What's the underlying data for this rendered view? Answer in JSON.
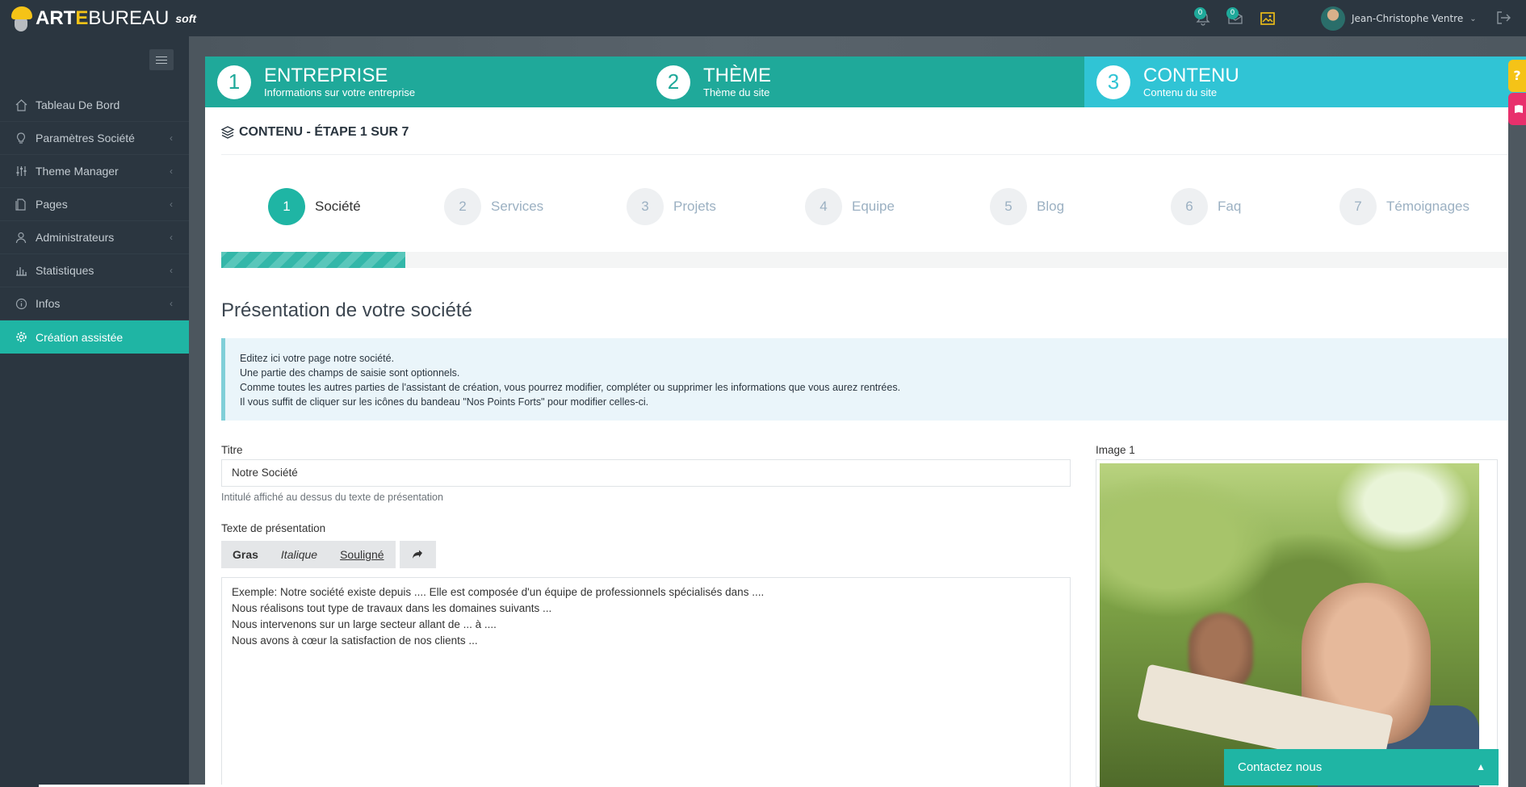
{
  "brand": {
    "logo_part1": "ART",
    "logo_e": "E",
    "logo_part2": "BUREAU",
    "logo_suffix": "soft"
  },
  "topbar": {
    "notifications_count": "0",
    "messages_count": "0",
    "user_name": "Jean-Christophe Ventre"
  },
  "sidebar": {
    "items": [
      {
        "label": "Tableau De Bord",
        "icon": "home-icon"
      },
      {
        "label": "Paramètres Société",
        "icon": "lightbulb-icon"
      },
      {
        "label": "Theme Manager",
        "icon": "sliders-icon"
      },
      {
        "label": "Pages",
        "icon": "pages-icon"
      },
      {
        "label": "Administrateurs",
        "icon": "user-icon"
      },
      {
        "label": "Statistiques",
        "icon": "bar-chart-icon"
      },
      {
        "label": "Infos",
        "icon": "info-icon"
      },
      {
        "label": "Création assistée",
        "icon": "gear-icon"
      }
    ]
  },
  "wizard": {
    "steps": [
      {
        "num": "1",
        "title": "ENTREPRISE",
        "subtitle": "Informations sur votre entreprise"
      },
      {
        "num": "2",
        "title": "THÈME",
        "subtitle": "Thème du site"
      },
      {
        "num": "3",
        "title": "CONTENU",
        "subtitle": "Contenu du site"
      }
    ],
    "help_tab": "?"
  },
  "card": {
    "title": "CONTENU - ÉTAPE 1 SUR 7",
    "substeps": [
      {
        "num": "1",
        "label": "Société"
      },
      {
        "num": "2",
        "label": "Services"
      },
      {
        "num": "3",
        "label": "Projets"
      },
      {
        "num": "4",
        "label": "Equipe"
      },
      {
        "num": "5",
        "label": "Blog"
      },
      {
        "num": "6",
        "label": "Faq"
      },
      {
        "num": "7",
        "label": "Témoignages"
      }
    ],
    "progress_fraction": 0.143,
    "section_title": "Présentation de votre société",
    "info_lines": [
      "Editez ici votre page notre société.",
      "Une partie des champs de saisie sont optionnels.",
      "Comme toutes les autres parties de l'assistant de création, vous pourrez modifier, compléter ou supprimer les informations que vous aurez rentrées.",
      "Il vous suffit de cliquer sur les icônes du bandeau \"Nos Points Forts\" pour modifier celles-ci."
    ],
    "title_label": "Titre",
    "title_value": "Notre Société",
    "title_help": "Intitulé affiché au dessus du texte de présentation",
    "presentation_label": "Texte de présentation",
    "toolbar": {
      "bold": "Gras",
      "italic": "Italique",
      "underline": "Souligné"
    },
    "presentation_lines": [
      "Exemple: Notre société existe depuis .... Elle est composée d'un équipe de professionnels spécialisés dans ....",
      "Nous réalisons tout type de travaux dans les domaines suivants ...",
      "Nous intervenons sur un large secteur allant de ... à ....",
      "Nous avons à cœur la satisfaction de nos clients ..."
    ],
    "image_label": "Image 1"
  },
  "contact": {
    "label": "Contactez nous"
  }
}
